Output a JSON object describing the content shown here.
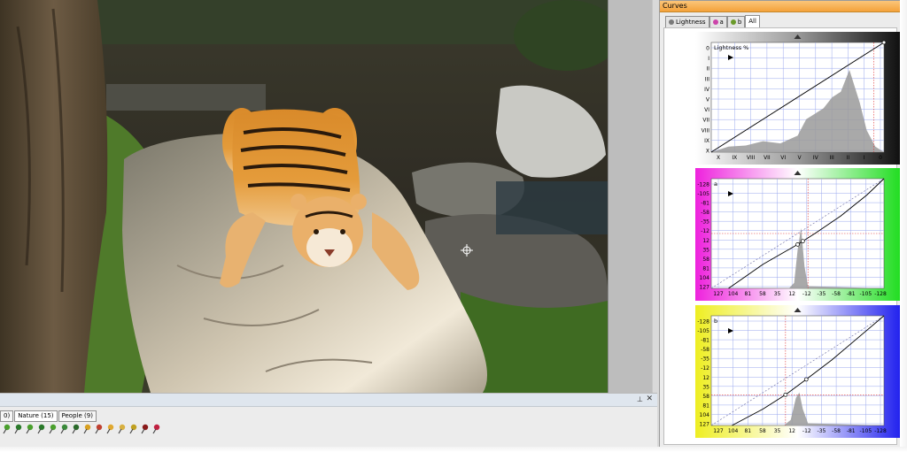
{
  "curves_panel": {
    "title": "Curves",
    "tabs": [
      {
        "label": "Lightness",
        "dot": "#7a7a7a"
      },
      {
        "label": "a",
        "dot": "#cc44aa"
      },
      {
        "label": "b",
        "dot": "#6a9a2a"
      },
      {
        "label": "All",
        "dot": ""
      }
    ],
    "lightness": {
      "label": "Lightness %",
      "y_ticks": [
        "0",
        "I",
        "II",
        "III",
        "IV",
        "V",
        "VI",
        "VII",
        "VIII",
        "IX",
        "X"
      ],
      "x_ticks": [
        "X",
        "IX",
        "VIII",
        "VII",
        "VI",
        "V",
        "IV",
        "III",
        "II",
        "I",
        "0"
      ]
    },
    "a_channel": {
      "label": "a",
      "y_ticks": [
        "-128",
        "-105",
        "-81",
        "-58",
        "-35",
        "-12",
        "12",
        "35",
        "58",
        "81",
        "104",
        "127"
      ],
      "x_ticks": [
        "127",
        "104",
        "81",
        "58",
        "35",
        "12",
        "-12",
        "-35",
        "-58",
        "-81",
        "-105",
        "-128"
      ]
    },
    "b_channel": {
      "label": "b",
      "y_ticks": [
        "-128",
        "-105",
        "-81",
        "-58",
        "-35",
        "-12",
        "12",
        "35",
        "58",
        "81",
        "104",
        "127"
      ],
      "x_ticks": [
        "127",
        "104",
        "81",
        "58",
        "35",
        "12",
        "-12",
        "-35",
        "-58",
        "-81",
        "-105",
        "-128"
      ]
    }
  },
  "bottom_panel": {
    "tabs": [
      {
        "label": "0)"
      },
      {
        "label": "Nature (15)"
      },
      {
        "label": "People (9)"
      }
    ],
    "pin_glyph": "⊥",
    "close_glyph": "✕",
    "pin_icons": [
      "#4aa02c",
      "#2a7a2a",
      "#4aa02c",
      "#2a7a2a",
      "#4aa02c",
      "#3a8a3a",
      "#2a6a2a",
      "#d8a020",
      "#c04030",
      "#e0a830",
      "#d8b040",
      "#c0a020",
      "#8a1a1a",
      "#c02040"
    ]
  },
  "colors": {
    "panel_title_orange": "#f4a23a",
    "a_left": "#ee22dd",
    "a_right": "#22dd22",
    "b_left": "#eeee22",
    "b_right": "#2222ee"
  }
}
